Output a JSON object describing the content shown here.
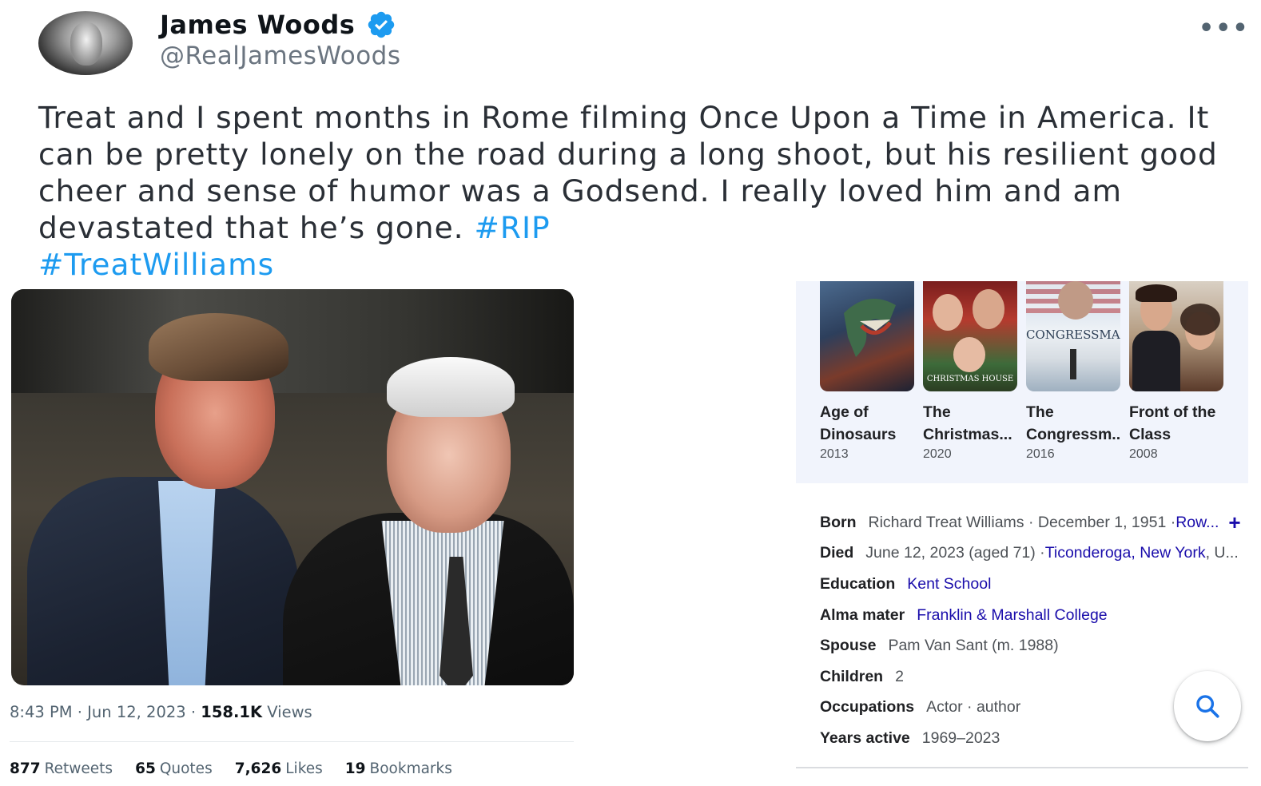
{
  "tweet": {
    "author_name": "James Woods",
    "handle": "@RealJamesWoods",
    "text": "Treat and I spent months in Rome filming Once Upon a Time in America. It can be pretty lonely on the road during a long shoot, but his resilient good cheer and sense of humor was a Godsend. I really loved him and am devastated that he’s gone. ",
    "hashtags": [
      "#RIP",
      "#TreatWilliams"
    ],
    "timestamp": "8:43 PM · Jun 12, 2023 · ",
    "views_count": "158.1K",
    "views_label": " Views",
    "stats": {
      "retweets_count": "877",
      "retweets_label": "Retweets",
      "quotes_count": "65",
      "quotes_label": "Quotes",
      "likes_count": "7,626",
      "likes_label": "Likes",
      "bookmarks_count": "19",
      "bookmarks_label": "Bookmarks"
    },
    "more_icon": "more-horizontal-icon",
    "verified_icon": "verified-badge-icon"
  },
  "knowledge_panel": {
    "films": [
      {
        "title_line1": "Age of",
        "title_line2": "Dinosaurs",
        "year": "2013"
      },
      {
        "title_line1": "The",
        "title_line2": "Christmas...",
        "year": "2020",
        "poster_text": "CHRISTMAS HOUSE"
      },
      {
        "title_line1": "The",
        "title_line2": "Congressm..",
        "year": "2016",
        "poster_text": "CONGRESSMAN"
      },
      {
        "title_line1": "Front of the",
        "title_line2": "Class",
        "year": "2008"
      }
    ],
    "facts": {
      "born_label": "Born",
      "born_value": "Richard Treat Williams · December 1, 1951 · ",
      "born_link": "Row...",
      "died_label": "Died",
      "died_value": "June 12, 2023 (aged 71) · ",
      "died_link": "Ticonderoga, New York",
      "died_suffix": ", U...",
      "education_label": "Education",
      "education_link": "Kent School",
      "alma_label": "Alma mater",
      "alma_link": "Franklin & Marshall College",
      "spouse_label": "Spouse",
      "spouse_value": "Pam Van Sant (m. 1988)",
      "children_label": "Children",
      "children_value": "2",
      "occupations_label": "Occupations",
      "occupations_value": "Actor · author",
      "years_label": "Years active",
      "years_value": "1969–2023"
    },
    "expand_icon": "plus-icon",
    "search_icon": "search-icon"
  },
  "colors": {
    "hashtag": "#1d9bf0",
    "link": "#1a0dab",
    "verified": "#1d9bf0",
    "panel_bg": "#f1f4fc"
  }
}
